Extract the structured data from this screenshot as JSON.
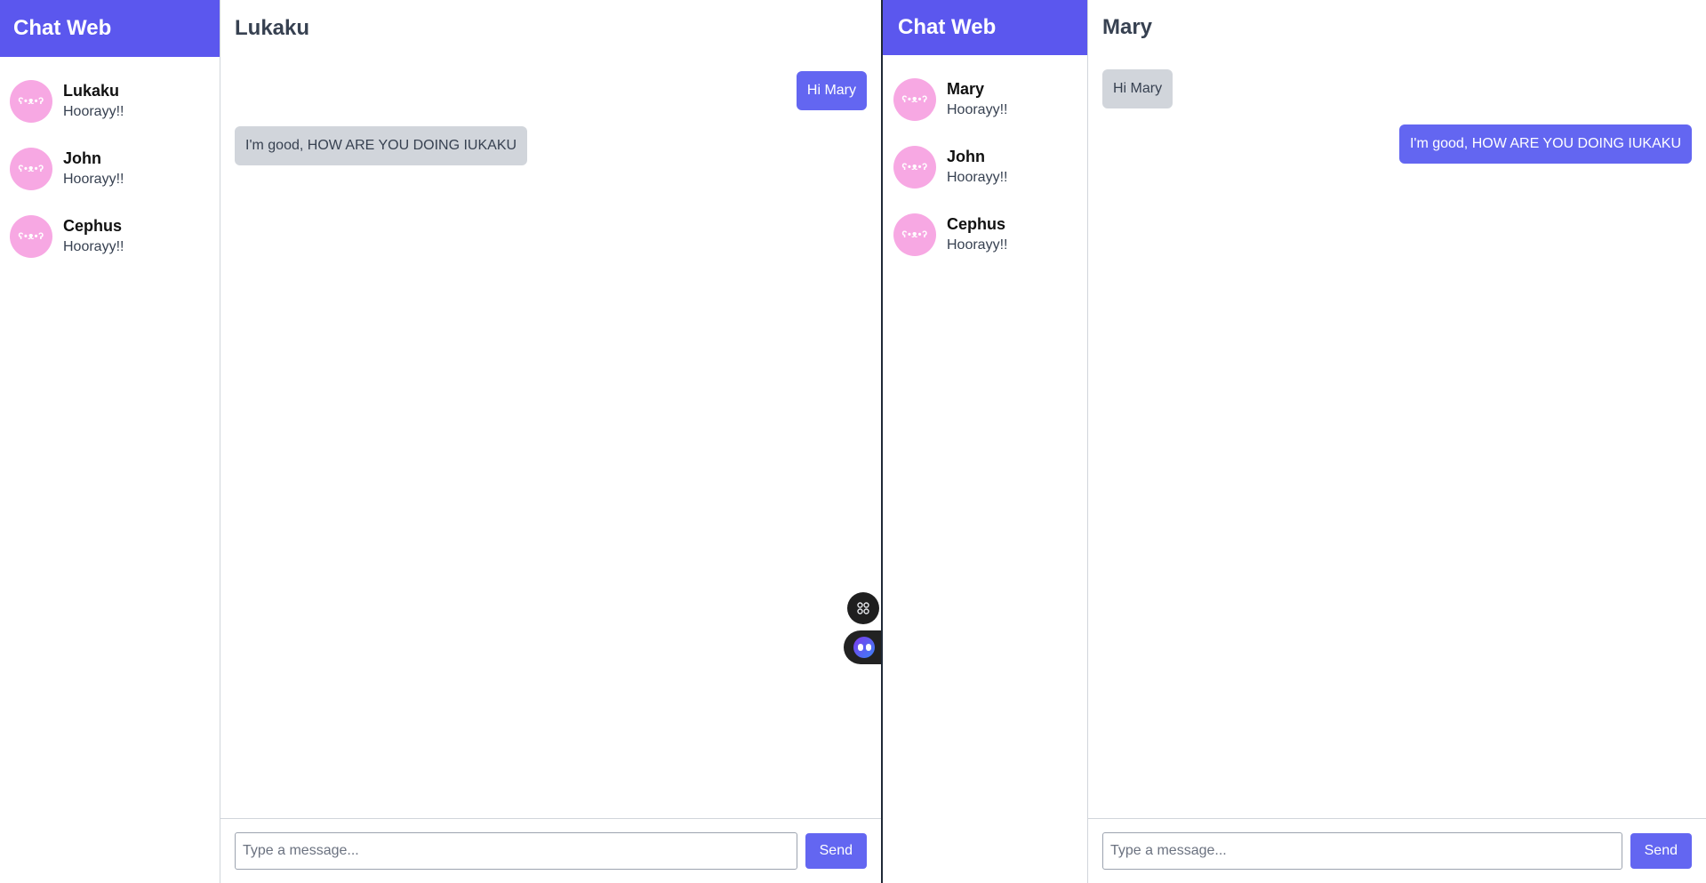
{
  "left": {
    "brand": "Chat Web",
    "contacts": [
      {
        "name": "Lukaku",
        "preview": "Hoorayy!!",
        "avatar_text": "ʕ•ᴥ•ʔ"
      },
      {
        "name": "John",
        "preview": "Hoorayy!!",
        "avatar_text": "ʕ•ᴥ•ʔ"
      },
      {
        "name": "Cephus",
        "preview": "Hoorayy!!",
        "avatar_text": "ʕ•ᴥ•ʔ"
      }
    ],
    "chat_title": "Lukaku",
    "messages": [
      {
        "direction": "out",
        "text": "Hi Mary"
      },
      {
        "direction": "in",
        "text": "I'm good, HOW ARE YOU DOING IUKAKU"
      }
    ],
    "composer": {
      "placeholder": "Type a message...",
      "value": "",
      "send_label": "Send"
    }
  },
  "right": {
    "brand": "Chat Web",
    "contacts": [
      {
        "name": "Mary",
        "preview": "Hoorayy!!",
        "avatar_text": "ʕ•ᴥ•ʔ"
      },
      {
        "name": "John",
        "preview": "Hoorayy!!",
        "avatar_text": "ʕ•ᴥ•ʔ"
      },
      {
        "name": "Cephus",
        "preview": "Hoorayy!!",
        "avatar_text": "ʕ•ᴥ•ʔ"
      }
    ],
    "chat_title": "Mary",
    "messages": [
      {
        "direction": "in",
        "text": "Hi Mary"
      },
      {
        "direction": "out",
        "text": "I'm good, HOW ARE YOU DOING IUKAKU"
      }
    ],
    "composer": {
      "placeholder": "Type a message...",
      "value": "",
      "send_label": "Send"
    }
  },
  "floating": {
    "grid_icon": "command-icon",
    "bot_icon": "assistant-bot-icon"
  },
  "colors": {
    "brand": "#5b57ee",
    "outgoing_bubble": "#6366f1",
    "incoming_bubble": "#d1d5db",
    "avatar": "#f7a8e3"
  }
}
